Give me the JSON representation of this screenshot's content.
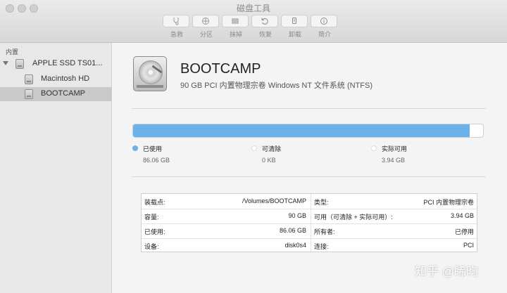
{
  "window": {
    "title": "磁盘工具"
  },
  "toolbar": {
    "items": [
      {
        "label": "急救",
        "icon": "stethoscope-icon"
      },
      {
        "label": "分区",
        "icon": "partition-icon"
      },
      {
        "label": "抹掉",
        "icon": "erase-icon"
      },
      {
        "label": "恢复",
        "icon": "restore-icon"
      },
      {
        "label": "卸载",
        "icon": "unmount-icon"
      },
      {
        "label": "简介",
        "icon": "info-icon"
      }
    ]
  },
  "sidebar": {
    "section_label": "内置",
    "disk": {
      "label": "APPLE SSD TS01...",
      "icon": "disk-icon"
    },
    "volumes": [
      {
        "label": "Macintosh HD",
        "icon": "disk-icon",
        "selected": false
      },
      {
        "label": "BOOTCAMP",
        "icon": "disk-icon",
        "selected": true
      }
    ]
  },
  "volume": {
    "name": "BOOTCAMP",
    "description": "90 GB PCI 内置物理宗卷 Windows NT 文件系统 (NTFS)",
    "icon": "hard-drive-icon"
  },
  "usage": {
    "used_fraction": 0.962,
    "legend": [
      {
        "name": "已使用",
        "value": "86.06 GB",
        "color": "#6bb1ea"
      },
      {
        "name": "可清除",
        "value": "0 KB",
        "color": "#ffffff"
      },
      {
        "name": "实际可用",
        "value": "3.94 GB",
        "color": "#ffffff"
      }
    ]
  },
  "info": {
    "rows": [
      {
        "left_key": "装载点:",
        "left_value": "/Volumes/BOOTCAMP",
        "right_key": "类型:",
        "right_value": "PCI 内置物理宗卷"
      },
      {
        "left_key": "容量:",
        "left_value": "90 GB",
        "right_key": "可用（可清除 + 实际可用）:",
        "right_value": "3.94 GB"
      },
      {
        "left_key": "已使用:",
        "left_value": "86.06 GB",
        "right_key": "所有者:",
        "right_value": "已停用"
      },
      {
        "left_key": "设备:",
        "left_value": "disk0s4",
        "right_key": "连接:",
        "right_value": "PCI"
      }
    ]
  },
  "watermark": "知乎 @睎昀"
}
